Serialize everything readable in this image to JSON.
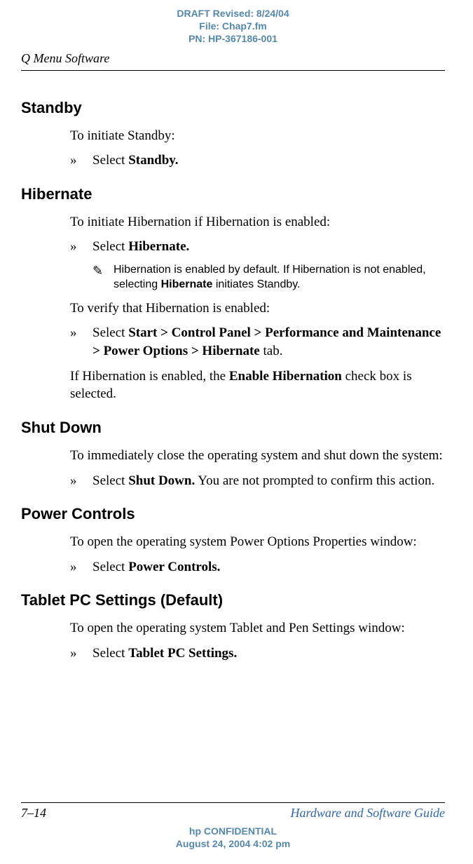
{
  "draft_header": {
    "line1": "DRAFT Revised: 8/24/04",
    "line2": "File: Chap7.fm",
    "line3": "PN: HP-367186-001"
  },
  "page_header": "Q Menu Software",
  "sections": {
    "standby": {
      "heading": "Standby",
      "intro": "To initiate Standby:",
      "bullet_marker": "»",
      "bullet_pre": "Select ",
      "bullet_bold": "Standby."
    },
    "hibernate": {
      "heading": "Hibernate",
      "intro": "To initiate Hibernation if Hibernation is enabled:",
      "bullet_marker": "»",
      "bullet_pre": "Select ",
      "bullet_bold": "Hibernate.",
      "note_icon": "✎",
      "note_pre": "Hibernation is enabled by default. If Hibernation is not enabled, selecting ",
      "note_bold": "Hibernate",
      "note_post": " initiates Standby.",
      "verify_intro": "To verify that Hibernation is enabled:",
      "verify_marker": "»",
      "verify_pre": "Select ",
      "verify_bold": "Start > Control Panel > Performance and Maintenance > Power Options > Hibernate",
      "verify_post": " tab.",
      "result_pre": "If Hibernation is enabled, the ",
      "result_bold": "Enable Hibernation",
      "result_post": " check box is selected."
    },
    "shutdown": {
      "heading": "Shut Down",
      "intro": "To immediately close the operating system and shut down the system:",
      "bullet_marker": "»",
      "bullet_pre": "Select ",
      "bullet_bold": "Shut Down.",
      "bullet_post": " You are not prompted to confirm this action."
    },
    "power": {
      "heading": "Power Controls",
      "intro": "To open the operating system Power Options Properties window:",
      "bullet_marker": "»",
      "bullet_pre": "Select ",
      "bullet_bold": "Power Controls."
    },
    "tablet": {
      "heading": "Tablet PC Settings (Default)",
      "intro": "To open the operating system Tablet and Pen Settings window:",
      "bullet_marker": "»",
      "bullet_pre": "Select ",
      "bullet_bold": "Tablet PC Settings."
    }
  },
  "footer": {
    "page_num": "7–14",
    "guide_title": "Hardware and Software Guide",
    "confidential_line1": "hp CONFIDENTIAL",
    "confidential_line2": "August 24, 2004 4:02 pm"
  }
}
